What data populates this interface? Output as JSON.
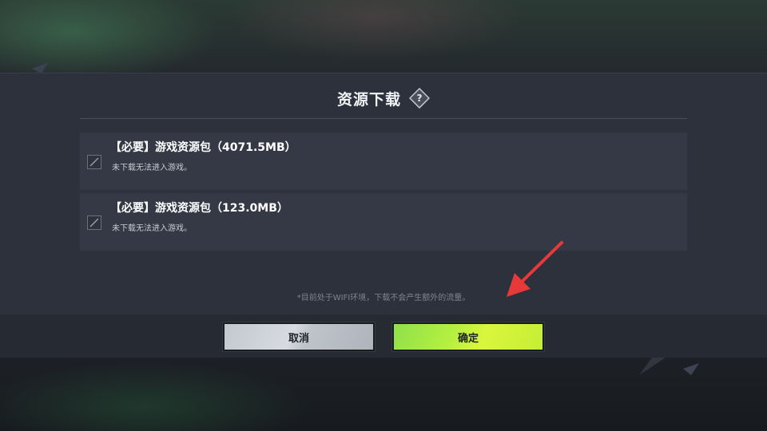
{
  "dialog": {
    "title": "资源下载",
    "help_icon": "question-diamond-icon",
    "help_glyph": "?"
  },
  "packages": [
    {
      "name": "【必要】游戏资源包（4071.5MB）",
      "desc": "未下载无法进入游戏。",
      "checked": true
    },
    {
      "name": "【必要】游戏资源包（123.0MB）",
      "desc": "未下载无法进入游戏。",
      "checked": true
    }
  ],
  "note": "*目前处于WIFI环境，下载不会产生额外的流量。",
  "buttons": {
    "cancel_label": "取消",
    "confirm_label": "确定"
  },
  "colors": {
    "accent_green": "#b6f040",
    "annotation_arrow": "#e8393a",
    "panel": "#2d313c"
  }
}
